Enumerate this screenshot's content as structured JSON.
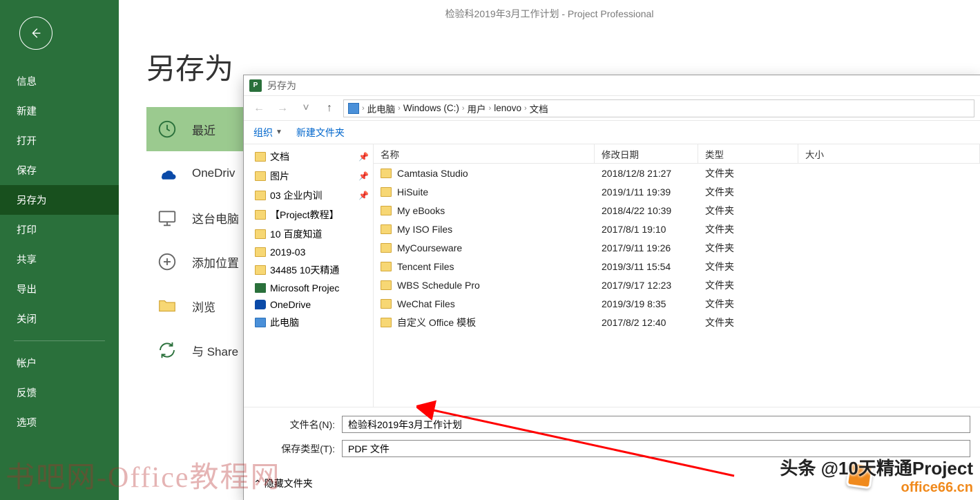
{
  "app_title": "检验科2019年3月工作计划  -  Project Professional",
  "sidebar": {
    "items": [
      "信息",
      "新建",
      "打开",
      "保存",
      "另存为",
      "打印",
      "共享",
      "导出",
      "关闭"
    ],
    "bottom": [
      "帐户",
      "反馈",
      "选项"
    ],
    "active": "另存为"
  },
  "page": {
    "title": "另存为"
  },
  "places": [
    {
      "label": "最近",
      "icon": "clock",
      "active": true
    },
    {
      "label": "OneDriv",
      "icon": "onedrive"
    },
    {
      "label": "这台电脑",
      "icon": "pc"
    },
    {
      "label": "添加位置",
      "icon": "add"
    },
    {
      "label": "浏览",
      "icon": "folder"
    },
    {
      "label": "与 Share",
      "icon": "sync"
    }
  ],
  "dialog": {
    "title": "另存为",
    "toolbar": {
      "organize": "组织",
      "newfolder": "新建文件夹"
    },
    "breadcrumb": [
      "此电脑",
      "Windows (C:)",
      "用户",
      "lenovo",
      "文档"
    ],
    "columns": {
      "name": "名称",
      "date": "修改日期",
      "type": "类型",
      "size": "大小"
    },
    "navpane": [
      {
        "label": "文档",
        "pin": true
      },
      {
        "label": "图片",
        "pin": true
      },
      {
        "label": "03 企业内训",
        "pin": true
      },
      {
        "label": "【Project教程】"
      },
      {
        "label": "10 百度知道"
      },
      {
        "label": "2019-03"
      },
      {
        "label": "34485 10天精通"
      },
      {
        "label": "Microsoft Projec",
        "kind": "proj"
      },
      {
        "label": "OneDrive",
        "kind": "od"
      },
      {
        "label": "此电脑",
        "kind": "pc"
      }
    ],
    "files": [
      {
        "name": "Camtasia Studio",
        "date": "2018/12/8 21:27",
        "type": "文件夹"
      },
      {
        "name": "HiSuite",
        "date": "2019/1/11 19:39",
        "type": "文件夹"
      },
      {
        "name": "My eBooks",
        "date": "2018/4/22 10:39",
        "type": "文件夹"
      },
      {
        "name": "My ISO Files",
        "date": "2017/8/1 19:10",
        "type": "文件夹"
      },
      {
        "name": "MyCourseware",
        "date": "2017/9/11 19:26",
        "type": "文件夹"
      },
      {
        "name": "Tencent Files",
        "date": "2019/3/11 15:54",
        "type": "文件夹"
      },
      {
        "name": "WBS Schedule Pro",
        "date": "2017/9/17 12:23",
        "type": "文件夹"
      },
      {
        "name": "WeChat Files",
        "date": "2019/3/19 8:35",
        "type": "文件夹"
      },
      {
        "name": "自定义 Office 模板",
        "date": "2017/8/2 12:40",
        "type": "文件夹"
      }
    ],
    "filename_label": "文件名(N):",
    "filename_value": "检验科2019年3月工作计划",
    "filetype_label": "保存类型(T):",
    "filetype_value": "PDF 文件",
    "hide_folders": "隐藏文件夹"
  },
  "watermarks": {
    "left": "书吧网-Office教程网",
    "right_top": "头条 @10天精通Project",
    "right_bottom": "office66.cn"
  }
}
